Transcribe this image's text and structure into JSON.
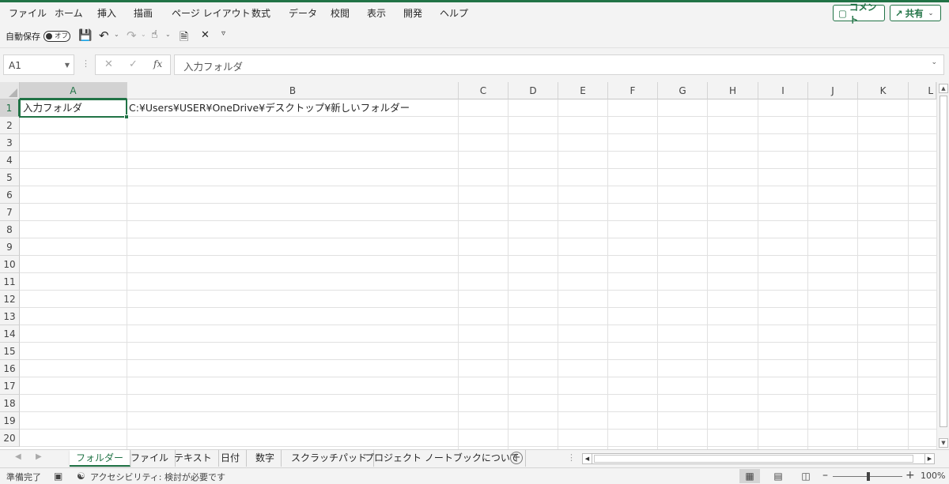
{
  "ribbon": {
    "tabs": [
      "ファイル",
      "ホーム",
      "挿入",
      "描画",
      "ページ レイアウト",
      "数式",
      "データ",
      "校閲",
      "表示",
      "開発",
      "ヘルプ"
    ],
    "comment_button": "コメント",
    "share_button": "共有"
  },
  "qat": {
    "autosave_label": "自動保存",
    "autosave_state": "オフ"
  },
  "formula_bar": {
    "name_box": "A1",
    "formula": "入力フォルダ"
  },
  "grid": {
    "columns": [
      "A",
      "B",
      "C",
      "D",
      "E",
      "F",
      "G",
      "H",
      "I",
      "J",
      "K",
      "L"
    ],
    "rows": [
      "1",
      "2",
      "3",
      "4",
      "5",
      "6",
      "7",
      "8",
      "9",
      "10",
      "11",
      "12",
      "13",
      "14",
      "15",
      "16",
      "17",
      "18",
      "19",
      "20"
    ],
    "cells": {
      "A1": "入力フォルダ",
      "B1": "C:¥Users¥USER¥OneDrive¥デスクトップ¥新しいフォルダー"
    },
    "selected_cell": "A1"
  },
  "sheets": {
    "tabs": [
      "フォルダー",
      "ファイル",
      "テキスト",
      "日付",
      "数字",
      "スクラッチパッド",
      "プロジェクト ノートブックについて"
    ],
    "active": "フォルダー"
  },
  "status": {
    "ready": "準備完了",
    "accessibility": "アクセシビリティ: 検討が必要です",
    "zoom": "100%"
  },
  "colors": {
    "accent": "#217346",
    "grid_line": "#e1e1e1",
    "header_bg": "#f3f3f3"
  }
}
